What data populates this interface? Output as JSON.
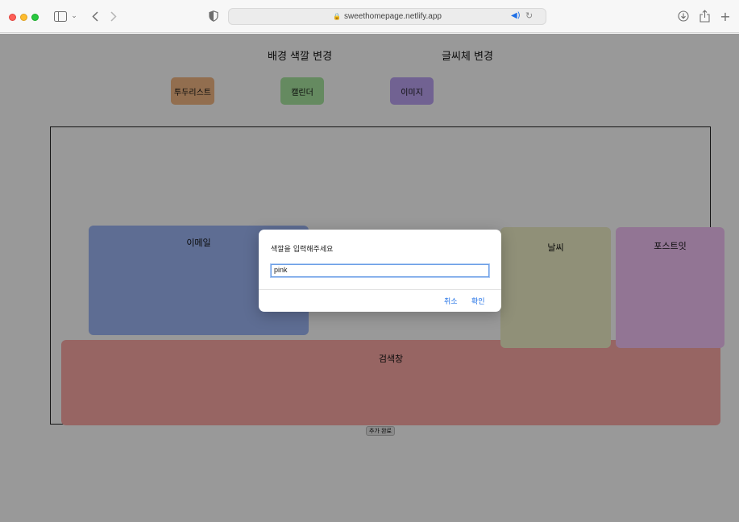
{
  "browser": {
    "url": "sweethomepage.netlify.app",
    "icons": {
      "sidebar": "sidebar-icon",
      "back": "chevron-left-icon",
      "forward": "chevron-right-icon",
      "shield": "privacy-shield-icon",
      "lock": "lock-icon",
      "speaker": "speaker-icon",
      "reload": "reload-icon",
      "download": "download-icon",
      "share": "share-icon",
      "new_tab": "plus-icon"
    }
  },
  "header": {
    "bg_color_link": "배경 색깔 변경",
    "font_link": "글씨체 변경"
  },
  "nav": {
    "todo": "투두리스트",
    "calendar": "캘린더",
    "image": "이미지"
  },
  "widgets": {
    "email": "이메일",
    "weather": "날씨",
    "postit": "포스트잇",
    "search": "검색창"
  },
  "add_done_label": "추가 완료",
  "dialog": {
    "message": "색깔을 입력해주세요",
    "input_value": "pink",
    "cancel": "취소",
    "ok": "확인"
  },
  "colors": {
    "todo": "#f3b884",
    "calendar": "#a8e6a1",
    "image": "#bca4f3",
    "email": "#9db6f6",
    "weather": "#f0f0c8",
    "postit": "#f4c3f7",
    "search": "#fca9a6",
    "accent": "#1e6fe6"
  }
}
